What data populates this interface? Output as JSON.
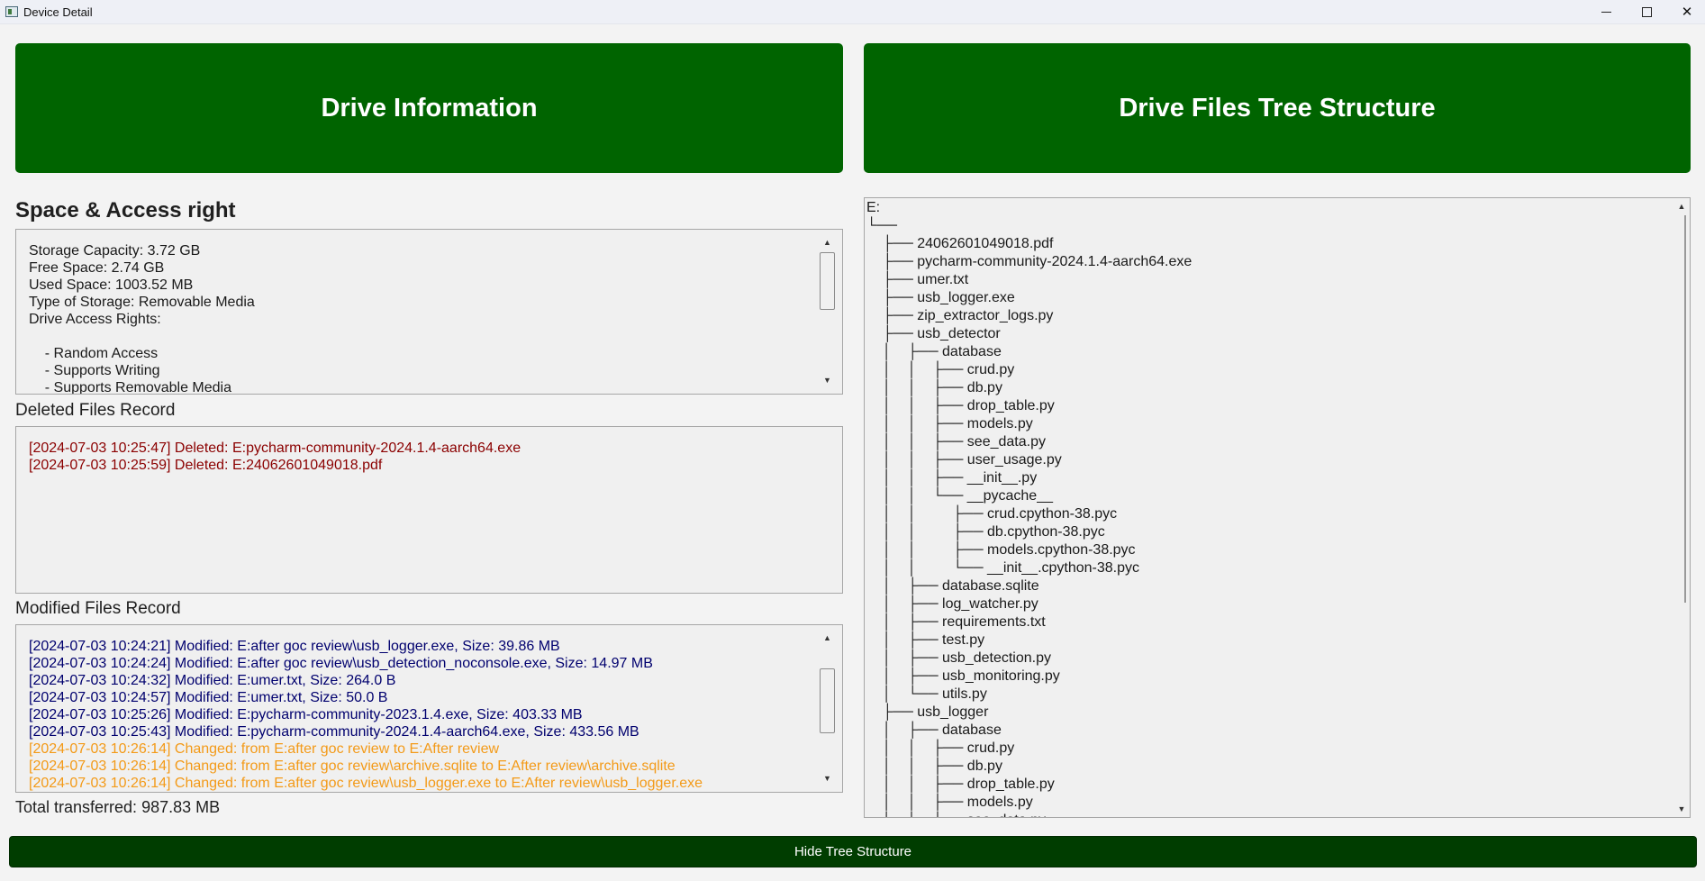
{
  "window": {
    "title": "Device Detail",
    "controls": [
      "minimize",
      "maximize",
      "close"
    ]
  },
  "headers": {
    "left": "Drive Information",
    "right": "Drive Files Tree Structure"
  },
  "space_access": {
    "title": "Space & Access right",
    "lines": [
      "Storage Capacity: 3.72 GB",
      "Free Space: 2.74 GB",
      "Used Space: 1003.52 MB",
      "Type of Storage: Removable Media",
      "Drive Access Rights:",
      "",
      "    - Random Access",
      "    - Supports Writing",
      "    - Supports Removable Media"
    ]
  },
  "deleted": {
    "title": "Deleted Files Record",
    "lines": [
      "[2024-07-03 10:25:47] Deleted: E:pycharm-community-2024.1.4-aarch64.exe",
      "[2024-07-03 10:25:59] Deleted: E:24062601049018.pdf"
    ],
    "color": "#8b0000"
  },
  "modified": {
    "title": "Modified Files Record",
    "lines": [
      {
        "text": "[2024-07-03 10:24:21] Modified: E:after goc review\\usb_logger.exe, Size: 39.86 MB",
        "kind": "modified"
      },
      {
        "text": "[2024-07-03 10:24:24] Modified: E:after goc review\\usb_detection_noconsole.exe, Size: 14.97 MB",
        "kind": "modified"
      },
      {
        "text": "[2024-07-03 10:24:32] Modified: E:umer.txt, Size: 264.0 B",
        "kind": "modified"
      },
      {
        "text": "[2024-07-03 10:24:57] Modified: E:umer.txt, Size: 50.0 B",
        "kind": "modified"
      },
      {
        "text": "[2024-07-03 10:25:26] Modified: E:pycharm-community-2023.1.4.exe, Size: 403.33 MB",
        "kind": "modified"
      },
      {
        "text": "[2024-07-03 10:25:43] Modified: E:pycharm-community-2024.1.4-aarch64.exe, Size: 433.56 MB",
        "kind": "modified"
      },
      {
        "text": "[2024-07-03 10:26:14] Changed: from E:after goc review to E:After review",
        "kind": "changed"
      },
      {
        "text": "[2024-07-03 10:26:14] Changed: from E:after goc review\\archive.sqlite to E:After review\\archive.sqlite",
        "kind": "changed"
      },
      {
        "text": "[2024-07-03 10:26:14] Changed: from E:after goc review\\usb_logger.exe to E:After review\\usb_logger.exe",
        "kind": "changed"
      }
    ],
    "colors": {
      "modified": "#00006e",
      "changed": "#f39a18"
    }
  },
  "total": "Total transferred: 987.83 MB",
  "tree": {
    "rows": [
      "E:",
      "└──",
      "    ├── 24062601049018.pdf",
      "    ├── pycharm-community-2024.1.4-aarch64.exe",
      "    ├── umer.txt",
      "    ├── usb_logger.exe",
      "    ├── zip_extractor_logs.py",
      "    ├── usb_detector",
      "    │    ├── database",
      "    │    │    ├── crud.py",
      "    │    │    ├── db.py",
      "    │    │    ├── drop_table.py",
      "    │    │    ├── models.py",
      "    │    │    ├── see_data.py",
      "    │    │    ├── user_usage.py",
      "    │    │    ├── __init__.py",
      "    │    │    └── __pycache__",
      "    │    │         ├── crud.cpython-38.pyc",
      "    │    │         ├── db.cpython-38.pyc",
      "    │    │         ├── models.cpython-38.pyc",
      "    │    │         └── __init__.cpython-38.pyc",
      "    │    ├── database.sqlite",
      "    │    ├── log_watcher.py",
      "    │    ├── requirements.txt",
      "    │    ├── test.py",
      "    │    ├── usb_detection.py",
      "    │    ├── usb_monitoring.py",
      "    │    └── utils.py",
      "    ├── usb_logger",
      "    │    ├── database",
      "    │    │    ├── crud.py",
      "    │    │    ├── db.py",
      "    │    │    ├── drop_table.py",
      "    │    │    ├── models.py",
      "    │    │    ├── see_data.py"
    ]
  },
  "bottom_button": "Hide Tree Structure",
  "colors": {
    "header_green": "#006400",
    "button_green": "#003d00"
  }
}
